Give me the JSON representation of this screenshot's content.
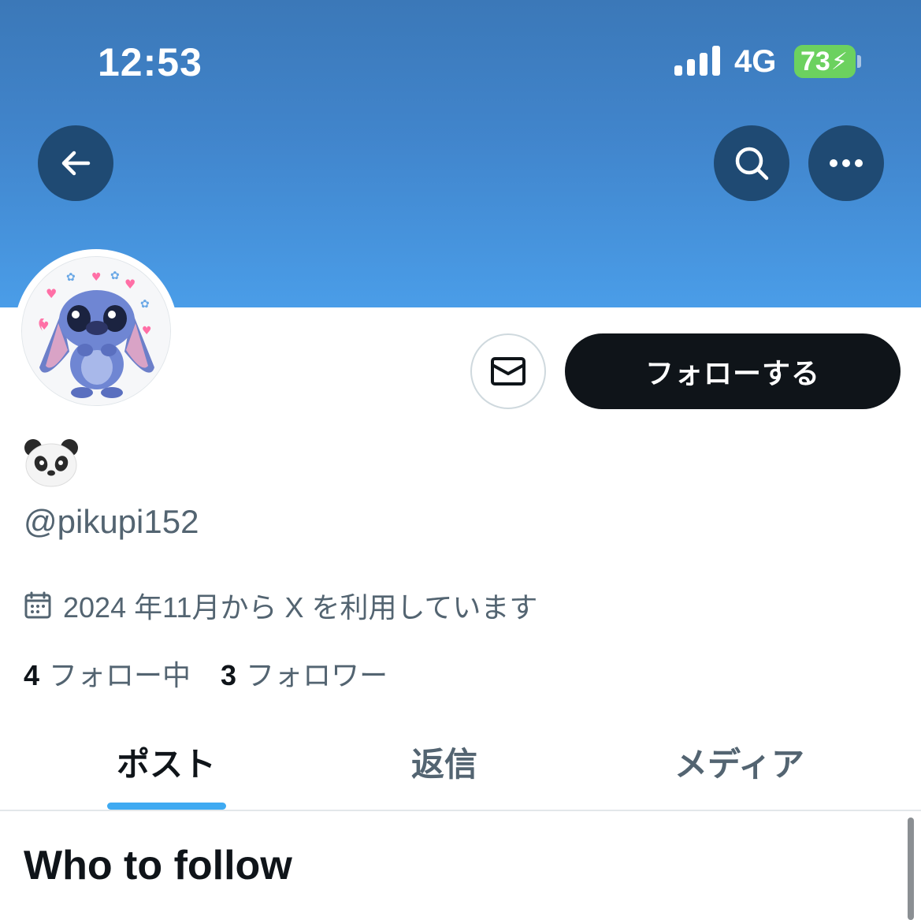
{
  "status_bar": {
    "time": "12:53",
    "network": "4G",
    "battery": "73"
  },
  "header": {
    "back_icon": "arrow-left-icon",
    "search_icon": "search-icon",
    "more_icon": "more-horizontal-icon"
  },
  "profile": {
    "display_name": "🐼",
    "handle": "@pikupi152",
    "joined": "2024 年11月から X を利用しています",
    "following_count": "4",
    "following_label": "フォロー中",
    "followers_count": "3",
    "followers_label": "フォロワー"
  },
  "actions": {
    "follow_label": "フォローする",
    "message_icon": "mail-icon"
  },
  "tabs": [
    {
      "label": "ポスト",
      "active": true
    },
    {
      "label": "返信",
      "active": false
    },
    {
      "label": "メディア",
      "active": false
    }
  ],
  "feed": {
    "section_title": "Who to follow"
  },
  "colors": {
    "accent": "#1d9bf0",
    "follow_button": "#0f1419",
    "banner": "#4a9de8",
    "battery": "#6cd15f"
  }
}
